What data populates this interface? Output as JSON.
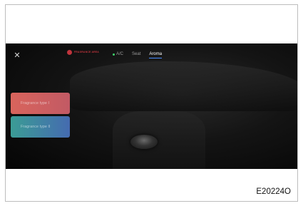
{
  "header": {
    "close_symbol": "✕",
    "logo_text": "FRAGRANCE AREA",
    "tabs": [
      {
        "label": "A/C",
        "status": "on"
      },
      {
        "label": "Seat"
      },
      {
        "label": "Aroma",
        "active": true
      }
    ]
  },
  "fragrance_options": [
    {
      "label": "Fragrance type I",
      "color_start": "#d9645c",
      "color_end": "#c25a64"
    },
    {
      "label": "Fragrance type II",
      "color_start": "#3b9c95",
      "color_end": "#456bb0"
    }
  ],
  "caption": "E20224O",
  "colors": {
    "active_tab_underline": "#4a8cff",
    "status_on": "#3ecf6a",
    "logo": "#c0343c"
  }
}
